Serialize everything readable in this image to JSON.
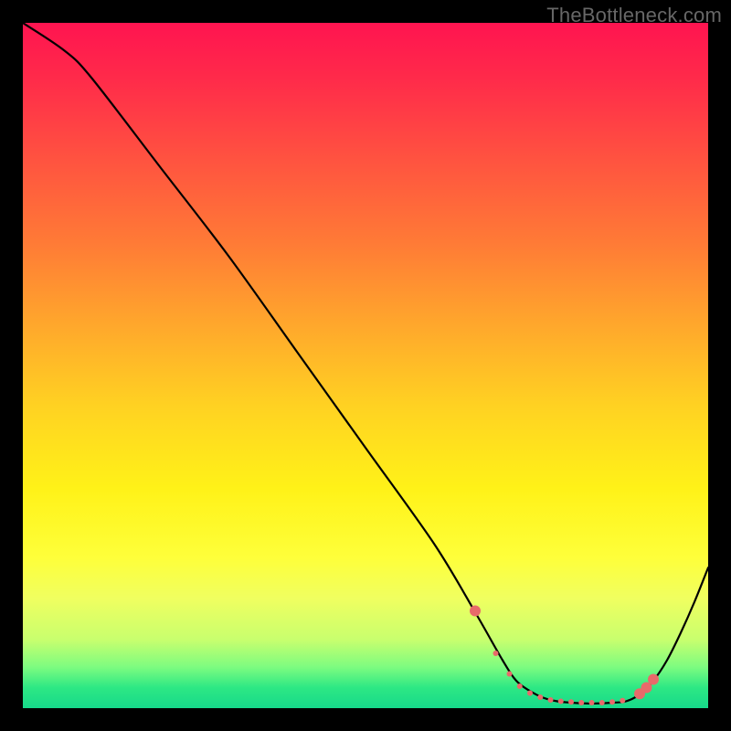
{
  "watermark": "TheBottleneck.com",
  "chart_data": {
    "type": "line",
    "title": "",
    "xlabel": "",
    "ylabel": "",
    "xlim": [
      0,
      100
    ],
    "ylim": [
      0,
      100
    ],
    "series": [
      {
        "name": "curve",
        "x": [
          0,
          6,
          10,
          20,
          30,
          40,
          50,
          60,
          66,
          70,
          72,
          74,
          76,
          78,
          80,
          82,
          84,
          86,
          88,
          90,
          92,
          94,
          96,
          98,
          100
        ],
        "y": [
          100,
          96,
          92,
          79,
          66,
          52,
          38,
          24,
          14,
          7,
          4,
          2.5,
          1.5,
          1.0,
          0.8,
          0.7,
          0.7,
          0.8,
          1.0,
          2.0,
          4.0,
          7.0,
          11.0,
          15.5,
          20.5
        ]
      }
    ],
    "markers": {
      "name": "valley-dots",
      "color": "#e86a6a",
      "x": [
        66,
        69,
        71,
        72.5,
        74,
        75.5,
        77,
        78.5,
        80,
        81.5,
        83,
        84.5,
        86,
        87.5,
        90,
        91,
        92
      ],
      "y": [
        14.2,
        8.0,
        5.0,
        3.2,
        2.2,
        1.6,
        1.2,
        1.0,
        0.9,
        0.8,
        0.8,
        0.8,
        0.9,
        1.1,
        2.1,
        3.0,
        4.2
      ],
      "size_pattern": [
        6,
        3,
        3,
        3,
        3,
        3,
        3,
        3,
        3,
        3,
        3,
        3,
        3,
        3,
        6,
        6,
        6
      ]
    }
  }
}
